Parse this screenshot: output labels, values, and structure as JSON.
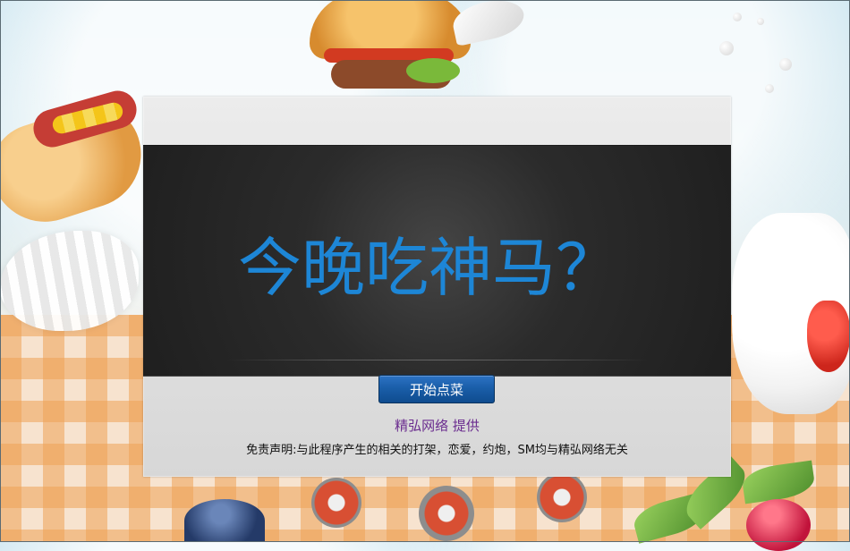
{
  "panel": {
    "headline": "今晚吃神马？",
    "button_label": "开始点菜",
    "provider": "精弘网络 提供",
    "disclaimer": "免责声明:与此程序产生的相关的打架，恋爱，约炮，SM均与精弘网络无关"
  },
  "colors": {
    "headline": "#1D86D6",
    "button": "#1A5EA9",
    "provider": "#6B2D8F",
    "panel_dark": "#2B2B2B",
    "panel_light": "#D7D7D7"
  },
  "icons": {
    "burger": "burger-illustration",
    "hotdog": "hotdog-illustration",
    "ice_cream": "ice-cream-illustration",
    "strawberry": "strawberry-illustration",
    "blueberry": "blueberry-illustration",
    "cherry": "cherry-illustration"
  }
}
